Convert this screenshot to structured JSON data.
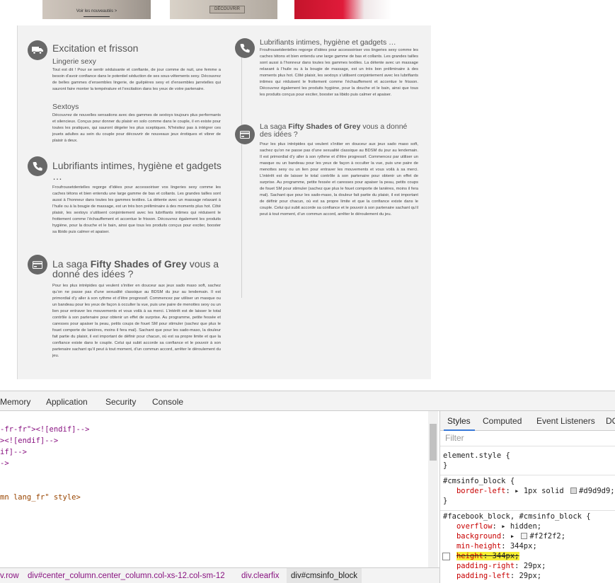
{
  "page": {
    "banners": [
      {
        "label": "Voir les nouveautés >"
      },
      {
        "label": "DÉCOUVRIR"
      }
    ],
    "left": {
      "s1": {
        "title": "Excitation et frisson",
        "subtitle": "Lingerie sexy",
        "p1": "Tout est dit ! Pour se sentir séduisante et confiante, de jour comme de nuit, une femme a besoin d’avoir confiance dans le potentiel séduction de ses sous-vêtements sexy. Découvrez de belles gammes d’ensembles lingerie, de guêpières sexy et d’ensembles jarretelles qui sauront faire monter la température et l’excitation dans les yeux de votre partenaire.",
        "subtitle2": "Sextoys",
        "p2": "Découvrez de nouvelles sensations avec des gammes de sextoys toujours plus performants et silencieux. Conçus pour donner du plaisir en solo comme dans le couple, il en existe pour toutes les pratiques, qui sauront dégeler les plus sceptiques. N’hésitez pas à intégrer ces jouets adultes au sein du couple pour découvrir de nouveaux jeux érotiques et vibrer de plaisir à deux."
      },
      "s2": {
        "title": "Lubrifiants intimes, hygiène et gadgets …",
        "p": "Froufrousetdentelles regorge d’idées pour accessoiriser vos lingeries sexy comme les caches tétons et bien entendu une large gamme de bas et collants. Les grandes tailles sont aussi à l’honneur dans toutes les gammes textiles. La détente avec un massage relaxant à l’huile ou à la bougie de massage, est un très bon préliminaire à des moments plus hot. Côté plaisir, les sextoys s’utilisent conjointement avec les lubrifiants intimes qui réduisent le frottement comme l’échauffement et accentue le frisson. Découvrez également les produits hygiène, pour la douche et le bain, ainsi que tous les produits conçus pour exciter, booster sa libido puis calmer et apaiser."
      },
      "s3": {
        "title_pre": "La saga ",
        "title_bold": "Fifty Shades of Grey",
        "title_post": " vous a donné des idées ?",
        "p": "Pour les plus intrépides qui veulent s’initier en douceur aux jeux sado maso soft, sachez qu’on ne passe pas d’une sexualité classique au BDSM du jour au lendemain. Il est primordial d’y aller à son rythme et d’être progressif. Commencez par utiliser un masque ou un bandeau pour les yeux de façon à occulter la vue, puis une paire de menottes sexy ou un lien pour entraver les mouvements et vous voilà à sa merci. L’intérêt est de laisser le total contrôle à son partenaire pour obtenir un effet de surprise. Au programme, petite fessée et caresses pour apaiser la peau, petits coups de fouet SM pour stimuler (sachez que plus le fouet comporte de lanières, moins il fera mal). Sachant que pour les sado-maso, la douleur fait partie du plaisir, il est important de définir pour chacun, où est sa propre limite et que la confiance existe dans le couple. Celui qui subit accorde sa confiance et le pouvoir à son partenaire sachant qu’il peut à tout moment, d’un commun accord, arrêter le déroulement du jeu."
      }
    },
    "right": {
      "s1": {
        "title": "Lubrifiants intimes, hygiène et gadgets …",
        "p": "Froufrousetdentelles regorge d’idées pour accessoiriser vos lingeries sexy comme les caches tétons et bien entendu une large gamme de bas et collants. Les grandes tailles sont aussi à l’honneur dans toutes les gammes textiles. La détente avec un massage relaxant à l’huile ou à la bougie de massage, est un très bon préliminaire à des moments plus hot. Côté plaisir, les sextoys s’utilisent conjointement avec les lubrifiants intimes qui réduisent le frottement comme l’échauffement et accentue le frisson. Découvrez également les produits hygiène, pour la douche et le bain, ainsi que tous les produits conçus pour exciter, booster sa libido puis calmer et apaiser."
      },
      "s2": {
        "title_pre": "La saga ",
        "title_bold": "Fifty Shades of Grey",
        "title_post": " vous a donné des idées ?",
        "p": "Pour les plus intrépides qui veulent s’initier en douceur aux jeux sado maso soft, sachez qu’on ne passe pas d’une sexualité classique au BDSM du jour au lendemain. Il est primordial d’y aller à son rythme et d’être progressif. Commencez par utiliser un masque ou un bandeau pour les yeux de façon à occulter la vue, puis une paire de menottes sexy ou un lien pour entraver les mouvements et vous voilà à sa merci. L’intérêt est de laisser le total contrôle à son partenaire pour obtenir un effet de surprise. Au programme, petite fessée et caresses pour apaiser la peau, petits coups de fouet SM pour stimuler (sachez que plus le fouet comporte de lanières, moins il fera mal). Sachant que pour les sado-maso, la douleur fait partie du plaisir, il est important de définir pour chacun, où est sa propre limite et que la confiance existe dans le couple. Celui qui subit accorde sa confiance et le pouvoir à son partenaire sachant qu’il peut à tout moment, d’un commun accord, arrêter le déroulement du jeu."
      }
    }
  },
  "devtools": {
    "tabs": [
      "Memory",
      "Application",
      "Security",
      "Console"
    ],
    "code_lines": [
      "-fr-fr\"><![endif]-->",
      "><![endif]-->",
      "if]-->",
      "->",
      "mn lang_fr\" style>"
    ],
    "breadcrumbs": [
      "v.row",
      "div#center_column.center_column.col-xs-12.col-sm-12",
      "div.clearfix",
      "div#cmsinfo_block"
    ],
    "styles_tabs": [
      "Styles",
      "Computed",
      "Event Listeners",
      "DO"
    ],
    "filter_placeholder": "Filter",
    "rules": {
      "r1_selector": "element.style {",
      "r2_selector": "#cmsinfo_block {",
      "r2_prop": "border-left",
      "r2_val": "1px solid",
      "r2_color": "#d9d9d9;",
      "r3_selector": "#facebook_block, #cmsinfo_block {",
      "overflow": "hidden;",
      "background_color": "#f2f2f2;",
      "min_height": "344px;",
      "height": "344px;",
      "padding_right": "29px;",
      "padding_left": "29px;"
    }
  }
}
